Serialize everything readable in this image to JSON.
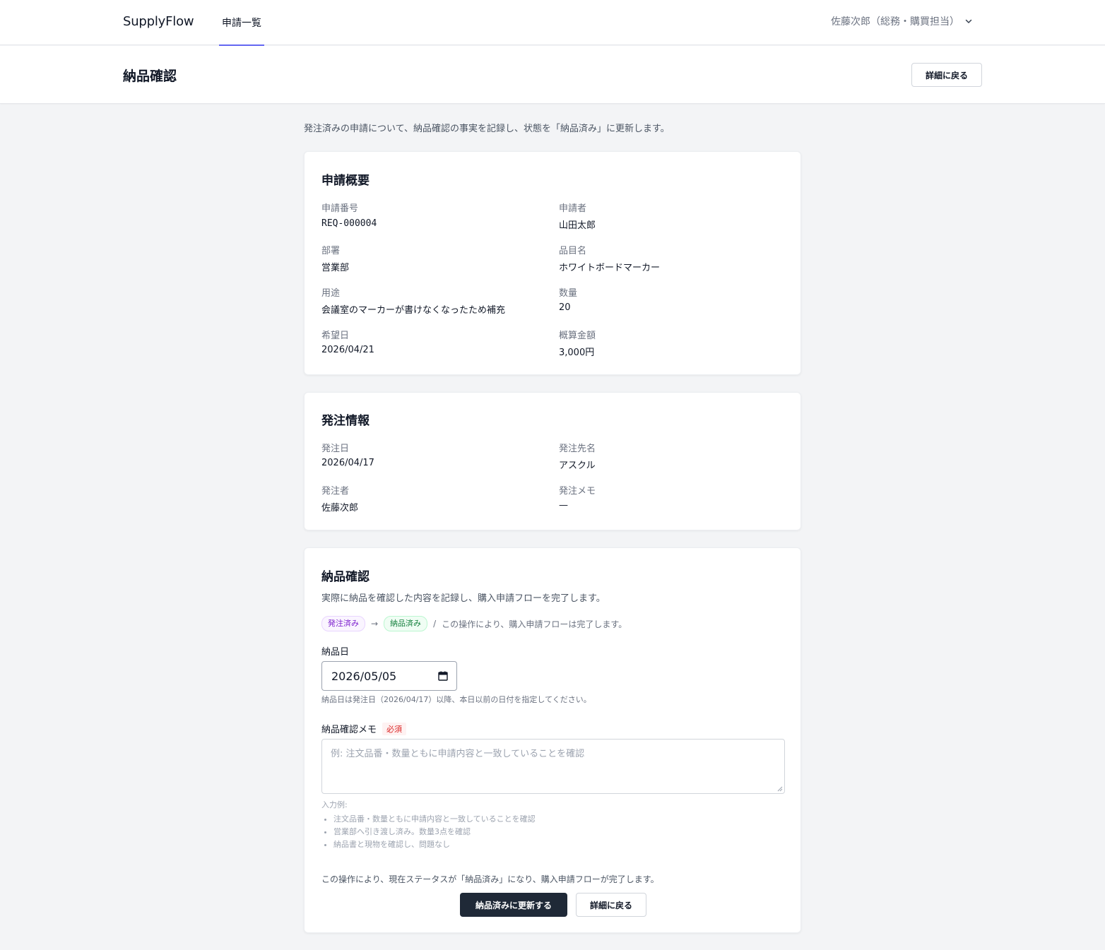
{
  "header": {
    "brand": "SupplyFlow",
    "nav_tab": "申請一覧",
    "user": "佐藤次郎（総務・購買担当）"
  },
  "page": {
    "title": "納品確認",
    "back_button": "詳細に戻る",
    "intro": "発注済みの申請について、納品確認の事実を記録し、状態を「納品済み」に更新します。"
  },
  "summary": {
    "title": "申請概要",
    "fields": [
      {
        "label": "申請番号",
        "value": "REQ-000004"
      },
      {
        "label": "申請者",
        "value": "山田太郎"
      },
      {
        "label": "部署",
        "value": "営業部"
      },
      {
        "label": "品目名",
        "value": "ホワイトボードマーカー"
      },
      {
        "label": "用途",
        "value": "会議室のマーカーが書けなくなったため補充"
      },
      {
        "label": "数量",
        "value": "20"
      },
      {
        "label": "希望日",
        "value": "2026/04/21"
      },
      {
        "label": "概算金額",
        "value": "3,000円"
      }
    ]
  },
  "order": {
    "title": "発注情報",
    "fields": [
      {
        "label": "発注日",
        "value": "2026/04/17"
      },
      {
        "label": "発注先名",
        "value": "アスクル"
      },
      {
        "label": "発注者",
        "value": "佐藤次郎"
      },
      {
        "label": "発注メモ",
        "value": "—"
      }
    ]
  },
  "delivery": {
    "title": "納品確認",
    "subtitle": "実際に納品を確認した内容を記録し、購入申請フローを完了します。",
    "status_from": "発注済み",
    "status_to": "納品済み",
    "arrow": "→",
    "separator": "/",
    "flow_note": "この操作により、購入申請フローは完了します。",
    "date_label": "納品日",
    "date_value": "2026/05/05",
    "date_help": "納品日は発注日（2026/04/17）以降、本日以前の日付を指定してください。",
    "memo_label": "納品確認メモ",
    "required": "必須",
    "memo_placeholder": "例: 注文品番・数量ともに申請内容と一致していることを確認",
    "examples_title": "入力例:",
    "examples": [
      "注文品番・数量ともに申請内容と一致していることを確認",
      "営業部へ引き渡し済み。数量3点を確認",
      "納品書と現物を確認し、問題なし"
    ],
    "confirm_note": "この操作により、現在ステータスが「納品済み」になり、購入申請フローが完了します。",
    "submit_button": "納品済みに更新する",
    "back_button": "詳細に戻る"
  },
  "colors": {
    "primary": "#1f2937",
    "accent": "#6366f1",
    "badge_purple": "#7e22ce",
    "badge_green": "#15803d",
    "required": "#dc2626"
  }
}
